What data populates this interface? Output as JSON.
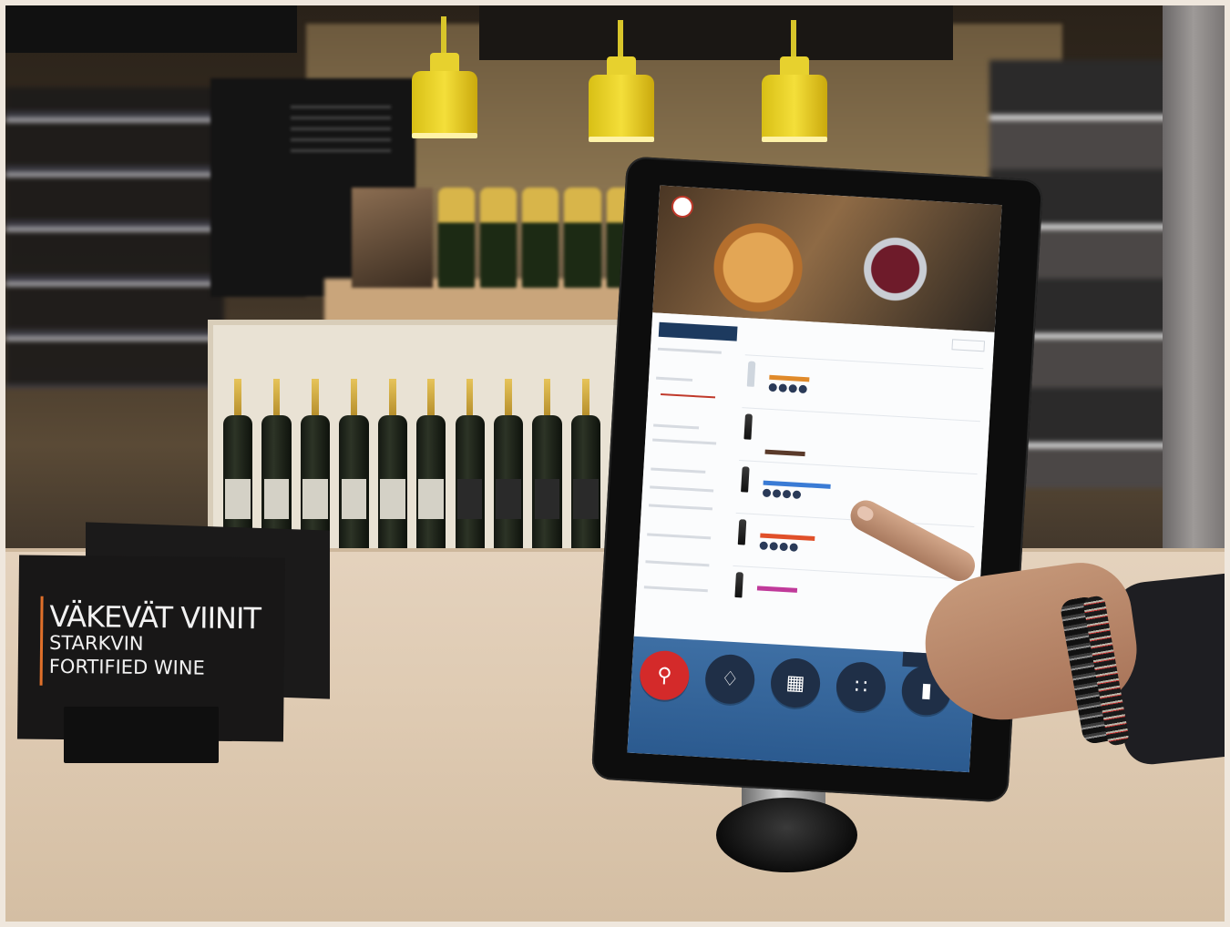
{
  "sign": {
    "line1": "VÄKEVÄT VIINIT",
    "line2": "STARKVIN",
    "line3": "FORTIFIED WINE"
  },
  "kiosk": {
    "dock": [
      {
        "icon": "search-icon",
        "active": true
      },
      {
        "icon": "deer-icon",
        "active": false
      },
      {
        "icon": "grid-icon",
        "active": false
      },
      {
        "icon": "grapes-icon",
        "active": false
      },
      {
        "icon": "bottle-icon",
        "active": false
      }
    ]
  },
  "colors": {
    "lamp": "#e7d12e",
    "sign_accent": "#e0702a",
    "dock": "#2b5a8f",
    "dock_active": "#d42a2a"
  }
}
